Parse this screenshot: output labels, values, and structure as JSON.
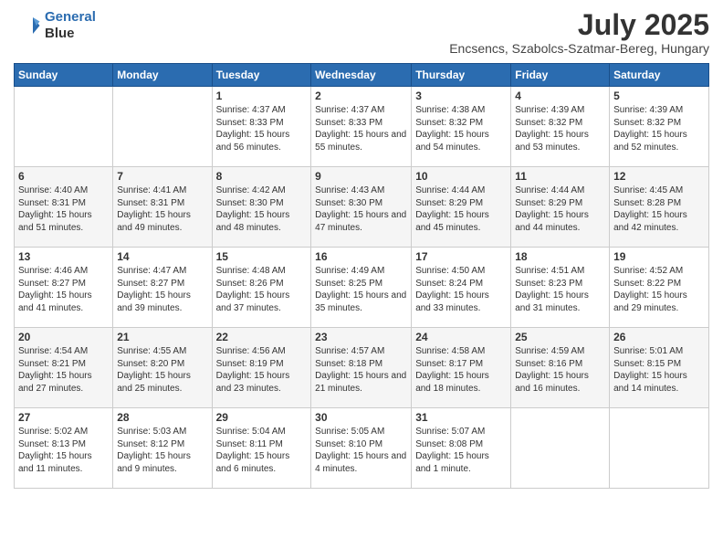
{
  "logo": {
    "line1": "General",
    "line2": "Blue"
  },
  "title": "July 2025",
  "subtitle": "Encsencs, Szabolcs-Szatmar-Bereg, Hungary",
  "days_header": [
    "Sunday",
    "Monday",
    "Tuesday",
    "Wednesday",
    "Thursday",
    "Friday",
    "Saturday"
  ],
  "weeks": [
    [
      {
        "day": "",
        "sunrise": "",
        "sunset": "",
        "daylight": ""
      },
      {
        "day": "",
        "sunrise": "",
        "sunset": "",
        "daylight": ""
      },
      {
        "day": "1",
        "sunrise": "Sunrise: 4:37 AM",
        "sunset": "Sunset: 8:33 PM",
        "daylight": "Daylight: 15 hours and 56 minutes."
      },
      {
        "day": "2",
        "sunrise": "Sunrise: 4:37 AM",
        "sunset": "Sunset: 8:33 PM",
        "daylight": "Daylight: 15 hours and 55 minutes."
      },
      {
        "day": "3",
        "sunrise": "Sunrise: 4:38 AM",
        "sunset": "Sunset: 8:32 PM",
        "daylight": "Daylight: 15 hours and 54 minutes."
      },
      {
        "day": "4",
        "sunrise": "Sunrise: 4:39 AM",
        "sunset": "Sunset: 8:32 PM",
        "daylight": "Daylight: 15 hours and 53 minutes."
      },
      {
        "day": "5",
        "sunrise": "Sunrise: 4:39 AM",
        "sunset": "Sunset: 8:32 PM",
        "daylight": "Daylight: 15 hours and 52 minutes."
      }
    ],
    [
      {
        "day": "6",
        "sunrise": "Sunrise: 4:40 AM",
        "sunset": "Sunset: 8:31 PM",
        "daylight": "Daylight: 15 hours and 51 minutes."
      },
      {
        "day": "7",
        "sunrise": "Sunrise: 4:41 AM",
        "sunset": "Sunset: 8:31 PM",
        "daylight": "Daylight: 15 hours and 49 minutes."
      },
      {
        "day": "8",
        "sunrise": "Sunrise: 4:42 AM",
        "sunset": "Sunset: 8:30 PM",
        "daylight": "Daylight: 15 hours and 48 minutes."
      },
      {
        "day": "9",
        "sunrise": "Sunrise: 4:43 AM",
        "sunset": "Sunset: 8:30 PM",
        "daylight": "Daylight: 15 hours and 47 minutes."
      },
      {
        "day": "10",
        "sunrise": "Sunrise: 4:44 AM",
        "sunset": "Sunset: 8:29 PM",
        "daylight": "Daylight: 15 hours and 45 minutes."
      },
      {
        "day": "11",
        "sunrise": "Sunrise: 4:44 AM",
        "sunset": "Sunset: 8:29 PM",
        "daylight": "Daylight: 15 hours and 44 minutes."
      },
      {
        "day": "12",
        "sunrise": "Sunrise: 4:45 AM",
        "sunset": "Sunset: 8:28 PM",
        "daylight": "Daylight: 15 hours and 42 minutes."
      }
    ],
    [
      {
        "day": "13",
        "sunrise": "Sunrise: 4:46 AM",
        "sunset": "Sunset: 8:27 PM",
        "daylight": "Daylight: 15 hours and 41 minutes."
      },
      {
        "day": "14",
        "sunrise": "Sunrise: 4:47 AM",
        "sunset": "Sunset: 8:27 PM",
        "daylight": "Daylight: 15 hours and 39 minutes."
      },
      {
        "day": "15",
        "sunrise": "Sunrise: 4:48 AM",
        "sunset": "Sunset: 8:26 PM",
        "daylight": "Daylight: 15 hours and 37 minutes."
      },
      {
        "day": "16",
        "sunrise": "Sunrise: 4:49 AM",
        "sunset": "Sunset: 8:25 PM",
        "daylight": "Daylight: 15 hours and 35 minutes."
      },
      {
        "day": "17",
        "sunrise": "Sunrise: 4:50 AM",
        "sunset": "Sunset: 8:24 PM",
        "daylight": "Daylight: 15 hours and 33 minutes."
      },
      {
        "day": "18",
        "sunrise": "Sunrise: 4:51 AM",
        "sunset": "Sunset: 8:23 PM",
        "daylight": "Daylight: 15 hours and 31 minutes."
      },
      {
        "day": "19",
        "sunrise": "Sunrise: 4:52 AM",
        "sunset": "Sunset: 8:22 PM",
        "daylight": "Daylight: 15 hours and 29 minutes."
      }
    ],
    [
      {
        "day": "20",
        "sunrise": "Sunrise: 4:54 AM",
        "sunset": "Sunset: 8:21 PM",
        "daylight": "Daylight: 15 hours and 27 minutes."
      },
      {
        "day": "21",
        "sunrise": "Sunrise: 4:55 AM",
        "sunset": "Sunset: 8:20 PM",
        "daylight": "Daylight: 15 hours and 25 minutes."
      },
      {
        "day": "22",
        "sunrise": "Sunrise: 4:56 AM",
        "sunset": "Sunset: 8:19 PM",
        "daylight": "Daylight: 15 hours and 23 minutes."
      },
      {
        "day": "23",
        "sunrise": "Sunrise: 4:57 AM",
        "sunset": "Sunset: 8:18 PM",
        "daylight": "Daylight: 15 hours and 21 minutes."
      },
      {
        "day": "24",
        "sunrise": "Sunrise: 4:58 AM",
        "sunset": "Sunset: 8:17 PM",
        "daylight": "Daylight: 15 hours and 18 minutes."
      },
      {
        "day": "25",
        "sunrise": "Sunrise: 4:59 AM",
        "sunset": "Sunset: 8:16 PM",
        "daylight": "Daylight: 15 hours and 16 minutes."
      },
      {
        "day": "26",
        "sunrise": "Sunrise: 5:01 AM",
        "sunset": "Sunset: 8:15 PM",
        "daylight": "Daylight: 15 hours and 14 minutes."
      }
    ],
    [
      {
        "day": "27",
        "sunrise": "Sunrise: 5:02 AM",
        "sunset": "Sunset: 8:13 PM",
        "daylight": "Daylight: 15 hours and 11 minutes."
      },
      {
        "day": "28",
        "sunrise": "Sunrise: 5:03 AM",
        "sunset": "Sunset: 8:12 PM",
        "daylight": "Daylight: 15 hours and 9 minutes."
      },
      {
        "day": "29",
        "sunrise": "Sunrise: 5:04 AM",
        "sunset": "Sunset: 8:11 PM",
        "daylight": "Daylight: 15 hours and 6 minutes."
      },
      {
        "day": "30",
        "sunrise": "Sunrise: 5:05 AM",
        "sunset": "Sunset: 8:10 PM",
        "daylight": "Daylight: 15 hours and 4 minutes."
      },
      {
        "day": "31",
        "sunrise": "Sunrise: 5:07 AM",
        "sunset": "Sunset: 8:08 PM",
        "daylight": "Daylight: 15 hours and 1 minute."
      },
      {
        "day": "",
        "sunrise": "",
        "sunset": "",
        "daylight": ""
      },
      {
        "day": "",
        "sunrise": "",
        "sunset": "",
        "daylight": ""
      }
    ]
  ]
}
